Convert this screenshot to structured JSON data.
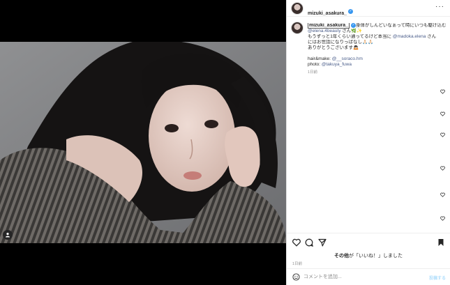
{
  "header": {
    "username": "mizuki_asakura_"
  },
  "caption": {
    "username": "mizuki_asakura_",
    "line1": "身体がしんどいなぁって時にいつも駆け込む",
    "line2_mention": "@elena.4beauty",
    "line2_rest": " さん🌿✨",
    "line3a": "もうずっと1年くらい通ってるけど本当に ",
    "line3_mention": "@madoka.elena",
    "line3b": " さん",
    "line4": "にはお世話になりっぱなし🙏🏻🙏🏻",
    "line5": "ありがとうございます🙇🏻",
    "credit1_label": "hair&make: ",
    "credit1_mention": "@__soraco.hm",
    "credit2_label": "photo: ",
    "credit2_mention": "@takuya_fuwa",
    "time": "1日前"
  },
  "likes": {
    "prefix": "その他",
    "suffix": "が「いいね！」しました"
  },
  "post_time": "1日前",
  "comment": {
    "placeholder": "コメントを追加...",
    "post_label": "投稿する"
  },
  "icons": {
    "more": "more-options-icon",
    "heart": "heart-icon",
    "comment": "comment-icon",
    "share": "share-icon",
    "save": "bookmark-icon",
    "emoji": "emoji-icon",
    "user_tag": "user-tag-icon",
    "verified": "verified-badge-icon"
  },
  "colors": {
    "accent": "#3897f0",
    "mention": "#4a5d8a",
    "muted": "#8e8e8e"
  }
}
